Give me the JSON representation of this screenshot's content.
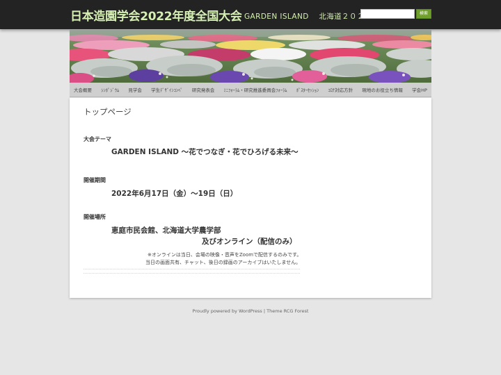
{
  "site": {
    "title": "日本造園学会2022年度全国大会",
    "description": "GARDEN ISLAND　 北海道２０２２"
  },
  "search": {
    "placeholder": "",
    "button_label": "検索"
  },
  "nav": {
    "items": [
      "大会概要",
      "ｼﾝﾎﾟｼﾞｳﾑ",
      "見学会",
      "学生ﾃﾞｻﾞｲﾝｺﾝﾍﾟ",
      "研究発表会",
      "ﾐﾆﾌｫｰﾗﾑ・研究推進委員会ﾌｫｰﾗﾑ",
      "ﾎﾟｽﾀｰｾｯｼｮﾝ",
      "ｺﾛﾅ対応方針",
      "現地のお役立ち情報",
      "学会HP"
    ]
  },
  "page": {
    "title": "トップページ",
    "theme_label": "大会テーマ",
    "theme_value": "GARDEN ISLAND 〜花でつなぎ・花でひろげる未来〜",
    "period_label": "開催期間",
    "period_value": "2022年6月17日（金）〜19日（日）",
    "venue_label": "開催場所",
    "venue_line1": "恵庭市民会館、北海道大学農学部",
    "venue_line2": "及びオンライン（配信のみ）",
    "note_line1": "※オンラインは当日、会場の映像・音声をZoomで配信するのみです。",
    "note_line2": "当日の画面共有、チャット、後日の録画のアーカイブはいたしません。"
  },
  "footer": {
    "powered": "Proudly powered by WordPress",
    "separator": " | ",
    "theme": "Theme RCG Forest"
  },
  "colors": {
    "topbar_bg": "#232323",
    "title_color": "#d6f0b4",
    "search_button": "#6fa02c",
    "nav_bg": "#cfcfcf",
    "page_bg": "#e6e6e6"
  }
}
